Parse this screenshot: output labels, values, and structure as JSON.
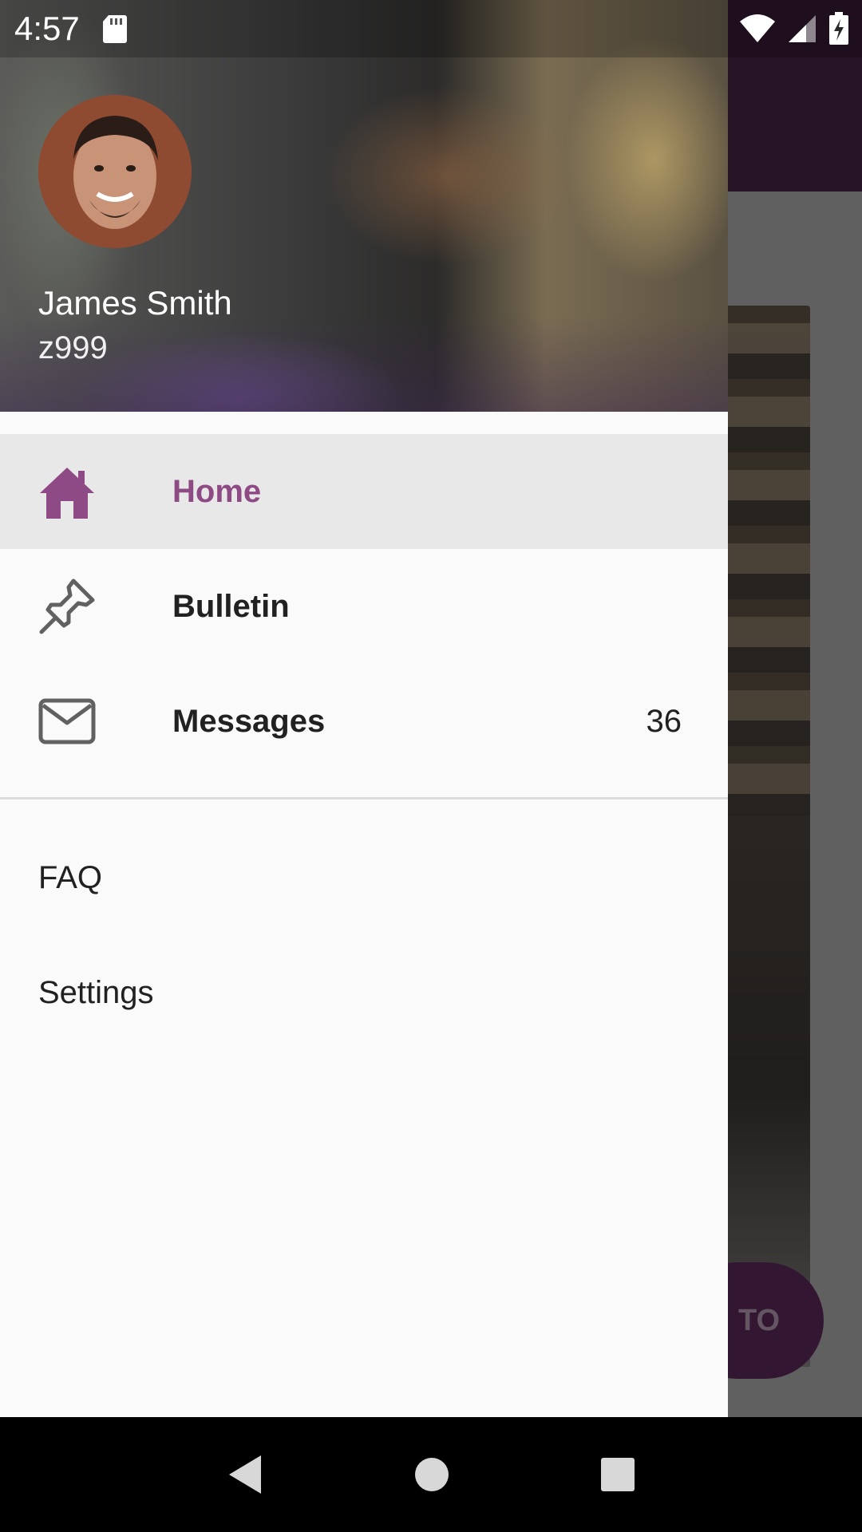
{
  "status_bar": {
    "time": "4:57",
    "icons": [
      "sd-card-icon",
      "wifi-icon",
      "signal-icon",
      "battery-charging-icon"
    ]
  },
  "background_app": {
    "fab_label": "TO",
    "toolbar_color": "#3a1e39"
  },
  "drawer": {
    "header": {
      "user_name": "James Smith",
      "user_id": "z999"
    },
    "nav_items": [
      {
        "label": "Home",
        "icon": "home-icon",
        "active": true,
        "count": ""
      },
      {
        "label": "Bulletin",
        "icon": "pushpin-icon",
        "active": false,
        "count": ""
      },
      {
        "label": "Messages",
        "icon": "mail-icon",
        "active": false,
        "count": "36"
      }
    ],
    "secondary_items": [
      {
        "label": "FAQ"
      },
      {
        "label": "Settings"
      }
    ]
  },
  "colors": {
    "accent": "#8e4a84",
    "active_row_bg": "#e8e8e8",
    "drawer_bg": "#fafafa"
  },
  "system_nav": {
    "buttons": [
      "back-icon",
      "home-circle-icon",
      "recents-icon"
    ]
  }
}
